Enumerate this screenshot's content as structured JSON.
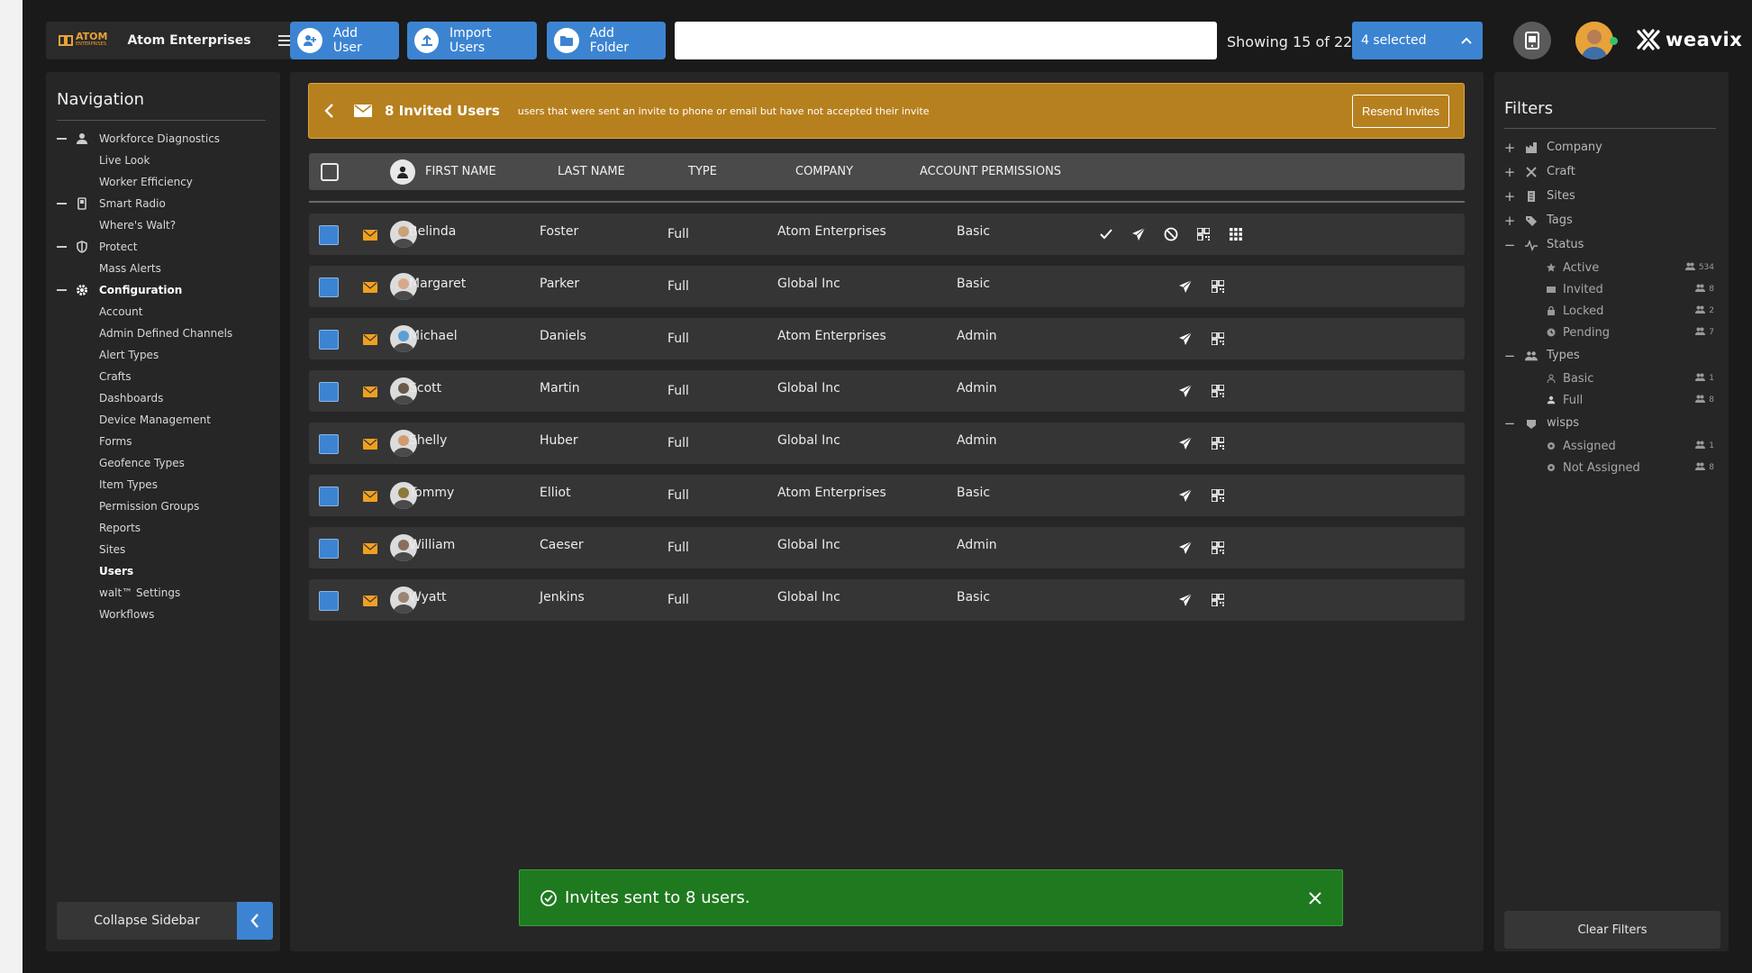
{
  "brand": {
    "logo_text": "ATOM",
    "logo_sub": "ENTERPRISES",
    "name": "Atom Enterprises"
  },
  "toolbar": {
    "add_user": "Add User",
    "import_users": "Import Users",
    "add_folder": "Add Folder",
    "search_value": "",
    "showing": "Showing 15 of 22",
    "selected": "4 selected"
  },
  "weavix": {
    "label": "weavix"
  },
  "nav": {
    "title": "Navigation",
    "items": [
      {
        "label": "Workforce Diagnostics",
        "level": 0,
        "icon": "person-icon"
      },
      {
        "label": "Live Look",
        "level": 1
      },
      {
        "label": "Worker Efficiency",
        "level": 1
      },
      {
        "label": "Smart Radio",
        "level": 0,
        "icon": "radio-icon"
      },
      {
        "label": "Where's Walt?",
        "level": 1
      },
      {
        "label": "Protect",
        "level": 0,
        "icon": "shield-icon"
      },
      {
        "label": "Mass Alerts",
        "level": 1
      },
      {
        "label": "Configuration",
        "level": 0,
        "icon": "gear-icon",
        "active": true
      },
      {
        "label": "Account",
        "level": 1
      },
      {
        "label": "Admin Defined Channels",
        "level": 1
      },
      {
        "label": "Alert Types",
        "level": 1
      },
      {
        "label": "Crafts",
        "level": 1
      },
      {
        "label": "Dashboards",
        "level": 1
      },
      {
        "label": "Device Management",
        "level": 1
      },
      {
        "label": "Forms",
        "level": 1
      },
      {
        "label": "Geofence Types",
        "level": 1
      },
      {
        "label": "Item Types",
        "level": 1
      },
      {
        "label": "Permission Groups",
        "level": 1
      },
      {
        "label": "Reports",
        "level": 1
      },
      {
        "label": "Sites",
        "level": 1
      },
      {
        "label": "Users",
        "level": 1,
        "active": true
      },
      {
        "label": "walt™ Settings",
        "level": 1
      },
      {
        "label": "Workflows",
        "level": 1
      }
    ],
    "collapse": "Collapse Sidebar"
  },
  "banner": {
    "title": "8 Invited Users",
    "subtitle": "users that were sent an invite to phone or email but have not accepted their invite",
    "resend": "Resend Invites"
  },
  "table": {
    "headers": [
      "FIRST NAME",
      "LAST NAME",
      "TYPE",
      "COMPANY",
      "ACCOUNT PERMISSIONS"
    ],
    "rows": [
      {
        "first": "Belinda",
        "last": "Foster",
        "type": "Full",
        "company": "Atom Enterprises",
        "perm": "Basic",
        "avatar": "#c9a27a",
        "expanded": true
      },
      {
        "first": "Margaret",
        "last": "Parker",
        "type": "Full",
        "company": "Global Inc",
        "perm": "Basic",
        "avatar": "#d7a98a"
      },
      {
        "first": "Michael",
        "last": "Daniels",
        "type": "Full",
        "company": "Atom Enterprises",
        "perm": "Admin",
        "avatar": "#5aa0d8"
      },
      {
        "first": "Scott",
        "last": "Martin",
        "type": "Full",
        "company": "Global Inc",
        "perm": "Admin",
        "avatar": "#6b5a4a"
      },
      {
        "first": "Shelly",
        "last": "Huber",
        "type": "Full",
        "company": "Global Inc",
        "perm": "Admin",
        "avatar": "#d39a72"
      },
      {
        "first": "Tommy",
        "last": "Elliot",
        "type": "Full",
        "company": "Atom Enterprises",
        "perm": "Basic",
        "avatar": "#8a7a3a"
      },
      {
        "first": "William",
        "last": "Caeser",
        "type": "Full",
        "company": "Global Inc",
        "perm": "Admin",
        "avatar": "#8a6e5c"
      },
      {
        "first": "Wyatt",
        "last": "Jenkins",
        "type": "Full",
        "company": "Global Inc",
        "perm": "Basic",
        "avatar": "#9a8574"
      }
    ]
  },
  "toast": {
    "message": "Invites sent to 8 users."
  },
  "filters": {
    "title": "Filters",
    "groups": [
      {
        "label": "Company",
        "sign": "+",
        "icon": "building-icon"
      },
      {
        "label": "Craft",
        "sign": "+",
        "icon": "tools-icon"
      },
      {
        "label": "Sites",
        "sign": "+",
        "icon": "site-icon"
      },
      {
        "label": "Tags",
        "sign": "+",
        "icon": "tag-icon"
      },
      {
        "label": "Status",
        "sign": "−",
        "icon": "pulse-icon",
        "children": [
          {
            "label": "Active",
            "count": "534",
            "icon": "star-icon"
          },
          {
            "label": "Invited",
            "count": "8",
            "icon": "mail-icon"
          },
          {
            "label": "Locked",
            "count": "2",
            "icon": "lock-icon"
          },
          {
            "label": "Pending",
            "count": "7",
            "icon": "clock-icon"
          }
        ]
      },
      {
        "label": "Types",
        "sign": "−",
        "icon": "people-icon",
        "children": [
          {
            "label": "Basic",
            "count": "1",
            "icon": "person-outline-icon"
          },
          {
            "label": "Full",
            "count": "8",
            "icon": "person-icon"
          }
        ]
      },
      {
        "label": "wisps",
        "sign": "−",
        "icon": "wisp-icon",
        "children": [
          {
            "label": "Assigned",
            "count": "1",
            "icon": "dot-icon"
          },
          {
            "label": "Not Assigned",
            "count": "8",
            "icon": "dot-icon"
          }
        ]
      }
    ],
    "clear": "Clear Filters"
  },
  "colors": {
    "accent": "#3c84d2",
    "banner": "#b7801e",
    "toast": "#1f7a1f",
    "envelope": "#f0a020"
  }
}
